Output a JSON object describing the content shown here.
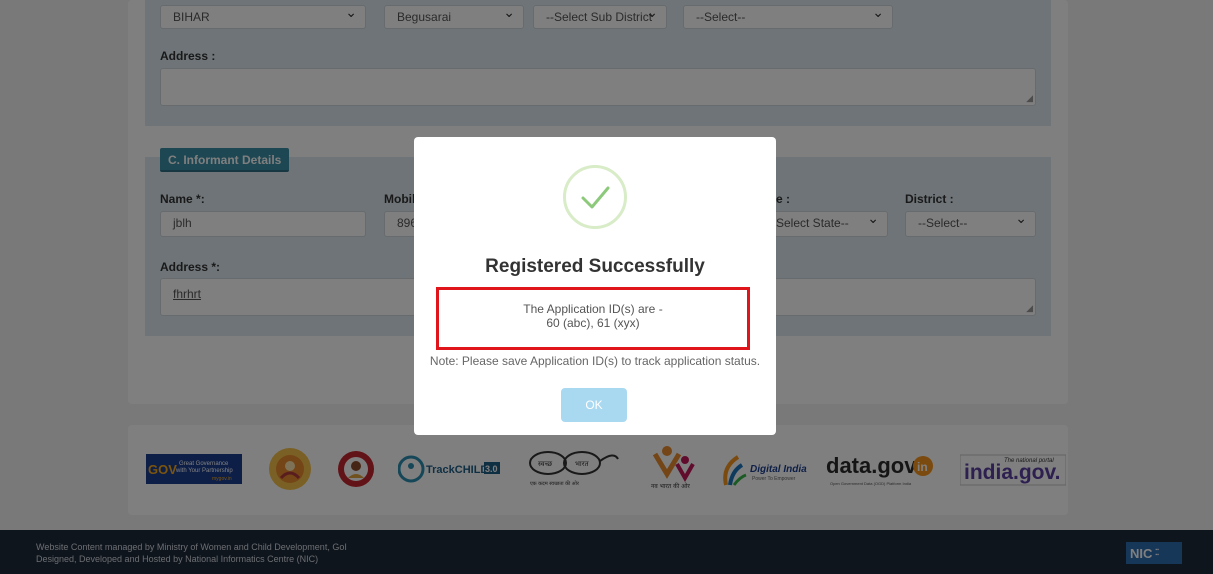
{
  "section_a": {
    "state_value": "BIHAR",
    "district_value": "Begusarai",
    "subdistrict_value": "--Select Sub District",
    "fourth_value": "--Select--",
    "address_label": "Address :",
    "address_value": ""
  },
  "section_c": {
    "tab_label": "C. Informant Details",
    "name_label": "Name *:",
    "name_value": "jblh",
    "mobile_label": "Mobile",
    "mobile_value": "8967",
    "state_label": "e :",
    "state_value": "Select State--",
    "district_label": "District :",
    "district_value": "--Select--",
    "address_label": "Address *:",
    "address_value": "fhrhrt"
  },
  "logos": {
    "mygov": {
      "big": "GOV",
      "line1": "Great Governance",
      "line2": "with Your Partnership",
      "tag": "mygov.in"
    },
    "trackchild": {
      "name": "TrackCHILD",
      "version": "3.0"
    },
    "swachh": {
      "left": "स्वच्छ",
      "right": "भारत",
      "sub": "एक कदम स्वच्छता की ओर"
    },
    "beti": {
      "sub": "नव भारत की ओर"
    },
    "digital_india": {
      "name": "Digital India",
      "sub": "Power To Empower"
    },
    "datagov": {
      "name": "data.gov",
      "in": "in",
      "sub": "Open Government Data (OGD) Platform India"
    },
    "indiagov": {
      "name": "india.gov.",
      "tag": "The national portal"
    }
  },
  "footer": {
    "line1": "Website Content managed by Ministry of Women and Child Development, GoI",
    "line2": "Designed, Developed and Hosted by National Informatics Centre (NIC)",
    "nic_logo": "NIC"
  },
  "modal": {
    "icon": "check-icon",
    "title": "Registered Successfully",
    "id_line1": "The Application ID(s) are -",
    "id_line2": "60 (abc), 61 (xyx)",
    "note": "Note: Please save Application ID(s) to track application status.",
    "ok_label": "OK"
  },
  "colors": {
    "section_bg": "#dde9ef",
    "tab_bg": "#3a8fa6",
    "highlight_border": "#e0141b",
    "ok_button": "#a9d8f1",
    "success_check": "#8cc97b",
    "footer_bg": "#1e2a3a"
  }
}
